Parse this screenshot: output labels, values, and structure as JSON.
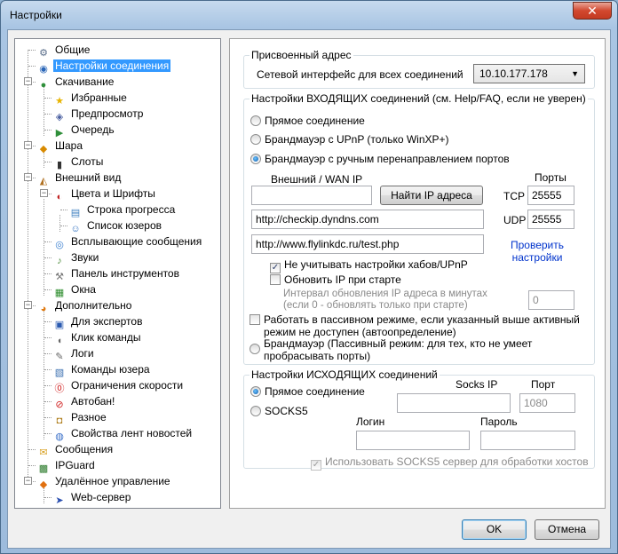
{
  "window": {
    "title": "Настройки",
    "close_glyph": "✕"
  },
  "tree": {
    "items": [
      {
        "label": "Общие",
        "icon": "settings-icon"
      },
      {
        "label": "Настройки соединения",
        "icon": "connection-icon",
        "selected": true
      },
      {
        "label": "Скачивание",
        "icon": "download-icon"
      },
      {
        "label": "Избранные",
        "icon": "star-icon"
      },
      {
        "label": "Предпросмотр",
        "icon": "preview-icon"
      },
      {
        "label": "Очередь",
        "icon": "queue-icon"
      },
      {
        "label": "Шара",
        "icon": "share-icon"
      },
      {
        "label": "Слоты",
        "icon": "slots-icon"
      },
      {
        "label": "Внешний вид",
        "icon": "appearance-icon"
      },
      {
        "label": "Цвета и Шрифты",
        "icon": "palette-icon"
      },
      {
        "label": "Строка прогресса",
        "icon": "progress-icon"
      },
      {
        "label": "Список юзеров",
        "icon": "users-icon"
      },
      {
        "label": "Всплывающие сообщения",
        "icon": "popup-icon"
      },
      {
        "label": "Звуки",
        "icon": "sound-icon"
      },
      {
        "label": "Панель инструментов",
        "icon": "toolbar-icon"
      },
      {
        "label": "Окна",
        "icon": "windows-icon"
      },
      {
        "label": "Дополнительно",
        "icon": "advanced-icon"
      },
      {
        "label": "Для экспертов",
        "icon": "expert-icon"
      },
      {
        "label": "Клик команды",
        "icon": "mouse-icon"
      },
      {
        "label": "Логи",
        "icon": "logs-icon"
      },
      {
        "label": "Команды юзера",
        "icon": "user-commands-icon"
      },
      {
        "label": "Ограничения скорости",
        "icon": "speed-limit-icon"
      },
      {
        "label": "Автобан!",
        "icon": "autoban-icon"
      },
      {
        "label": "Разное",
        "icon": "misc-icon"
      },
      {
        "label": "Свойства лент новостей",
        "icon": "rss-icon"
      },
      {
        "label": "Сообщения",
        "icon": "messages-icon"
      },
      {
        "label": "IPGuard",
        "icon": "ipguard-icon"
      },
      {
        "label": "Удалённое управление",
        "icon": "remote-icon"
      },
      {
        "label": "Web-сервер",
        "icon": "webserver-icon"
      }
    ]
  },
  "assigned": {
    "title": "Присвоенный адрес",
    "label": "Сетевой интерфейс для всех соединений",
    "value": "10.10.177.178",
    "arrow": "▼"
  },
  "incoming": {
    "title": "Настройки ВХОДЯЩИХ соединений (см. Help/FAQ, если не уверен)",
    "radio_direct": "Прямое соединение",
    "radio_upnp": "Брандмауэр с UPnP (только WinXP+)",
    "radio_manual": "Брандмауэр с ручным перенаправлением портов",
    "wan_label": "Внешний / WAN IP",
    "ports_label": "Порты",
    "find_ip": "Найти IP адреса",
    "tcp_label": "TCP",
    "tcp_value": "25555",
    "udp_label": "UDP",
    "udp_value": "25555",
    "url1": "http://checkip.dyndns.com",
    "url2": "http://www.flylinkdc.ru/test.php",
    "check_link": "Проверить настройки",
    "ignore_hub": "Не учитывать настройки хабов/UPnP",
    "update_ip": "Обновить IP при старте",
    "interval_label": "Интервал обновления IP адреса в минутах (если 0 - обновлять только при старте)",
    "interval_value": "0",
    "passive_check": "Работать в пассивном режиме, если указанный выше активный режим не доступен (автоопределение)",
    "radio_passive": "Брандмауэр (Пассивный режим: для тех, кто не умеет пробрасывать порты)",
    "check_glyph": "✓"
  },
  "outgoing": {
    "title": "Настройки ИСХОДЯЩИХ соединений",
    "radio_direct": "Прямое соединение",
    "radio_socks": "SOCKS5",
    "socks_ip_label": "Socks IP",
    "port_label": "Порт",
    "port_value": "1080",
    "login_label": "Логин",
    "password_label": "Пароль",
    "use_socks": "Использовать SOCKS5 сервер для обработки хостов"
  },
  "footer": {
    "ok": "OK",
    "cancel": "Отмена"
  },
  "colors": {
    "accent": "#3399ff",
    "link": "#0033cc",
    "title_close": "#d2482f"
  }
}
